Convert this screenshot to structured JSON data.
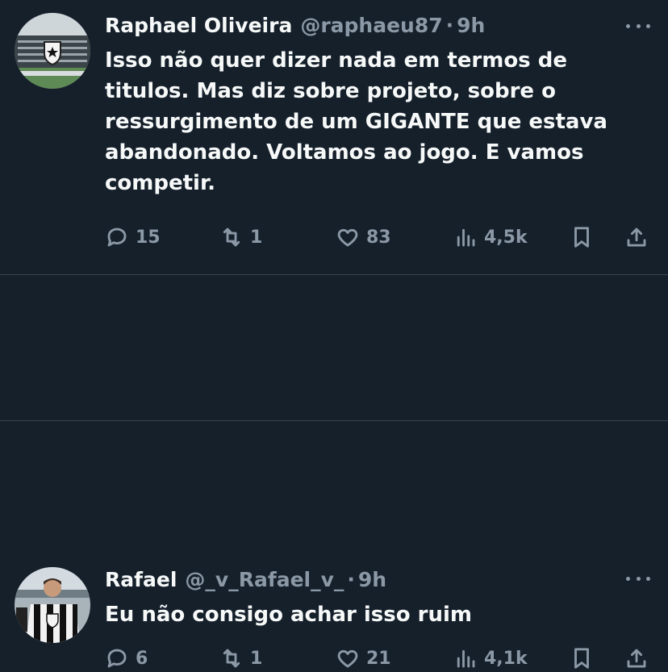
{
  "tweets": [
    {
      "name": "Raphael Oliveira",
      "handle": "@raphaeu87",
      "dot": "·",
      "time": "9h",
      "text": "Isso não quer dizer nada em termos de\ntitulos. Mas diz sobre projeto, sobre o\nressurgimento de um GIGANTE que estava\nabandonado. Voltamos ao jogo. E vamos\ncompetir.",
      "replies": "15",
      "retweets": "1",
      "likes": "83",
      "views": "4,5k"
    },
    {
      "name": "Rafael",
      "handle": "@_v_Rafael_v_",
      "dot": "·",
      "time": "9h",
      "text": "Eu não consigo achar isso ruim",
      "replies": "6",
      "retweets": "1",
      "likes": "21",
      "views": "4,1k"
    }
  ],
  "colors": {
    "background": "#15202b",
    "text": "#f7f9f9",
    "muted": "#8b98a5",
    "divider": "#38444d"
  },
  "icons": [
    "reply-icon",
    "retweet-icon",
    "like-icon",
    "views-icon",
    "bookmark-icon",
    "share-icon",
    "more-icon"
  ]
}
